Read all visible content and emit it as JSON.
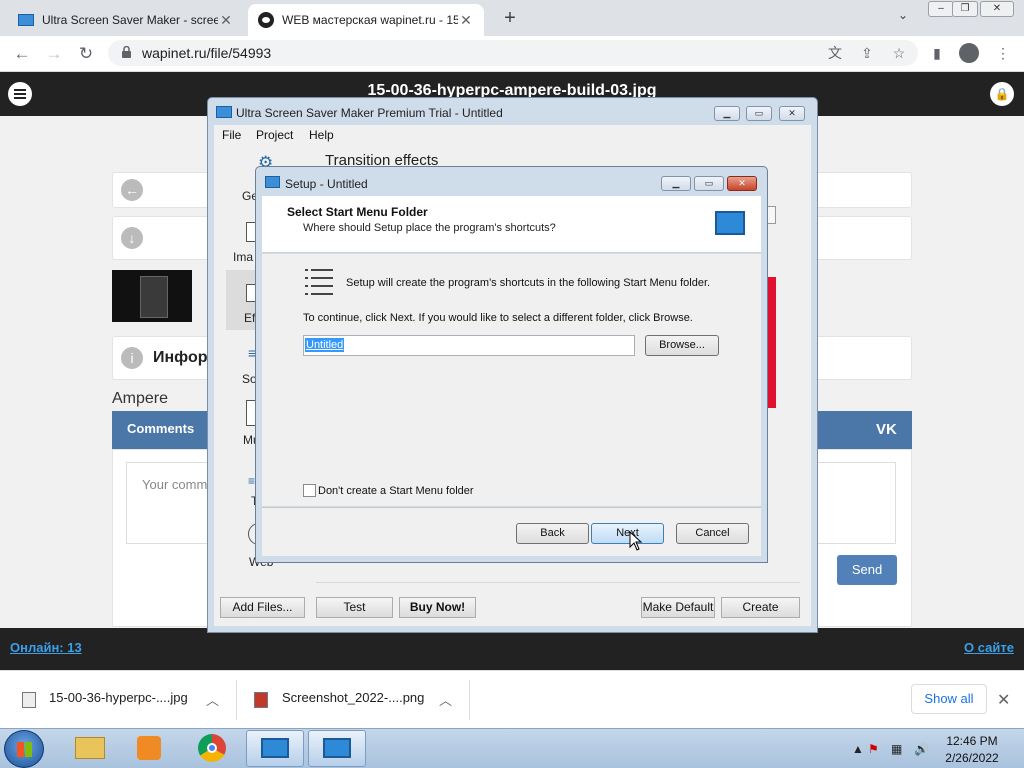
{
  "browser": {
    "tabs": [
      {
        "title": "Ultra Screen Saver Maker - screen"
      },
      {
        "title": "WEB мастерская wapinet.ru - 15"
      }
    ],
    "address": "wapinet.ru/file/54993"
  },
  "page": {
    "file_title": "15-00-36-hyperpc-ampere-build-03.jpg",
    "info_title": "Инфор",
    "name": "Ampere",
    "comments_label": "Comments",
    "vk_label": "VK",
    "comment_placeholder": "Your comm",
    "send_label": "Send",
    "online_label": "Онлайн: 13",
    "about_label": "О сайте"
  },
  "ussWindow": {
    "title": "Ultra Screen Saver Maker Premium Trial - Untitled",
    "menu": [
      "File",
      "Project",
      "Help"
    ],
    "side_labels": [
      "Ge",
      "Ima",
      "Eff",
      "So",
      "Mu",
      "T",
      "Web"
    ],
    "section_title": "Transition effects",
    "buttons": [
      "Add Files...",
      "Test",
      "Buy Now!",
      "Make Default",
      "Create"
    ]
  },
  "setup": {
    "title": "Setup - Untitled",
    "header_title": "Select Start Menu Folder",
    "header_subtitle": "Where should Setup place the program's shortcuts?",
    "body_text1": "Setup will create the program's shortcuts in the following Start Menu folder.",
    "body_text2": "To continue, click Next. If you would like to select a different folder, click Browse.",
    "folder_value": "Untitled",
    "browse_label": "Browse...",
    "checkbox_label": "Don't create a Start Menu folder",
    "back_label": "Back",
    "next_label": "Next",
    "cancel_label": "Cancel"
  },
  "downloads": {
    "items": [
      "15-00-36-hyperpc-....jpg",
      "Screenshot_2022-....png"
    ],
    "show_all": "Show all"
  },
  "taskbar": {
    "time": "12:46 PM",
    "date": "2/26/2022"
  }
}
